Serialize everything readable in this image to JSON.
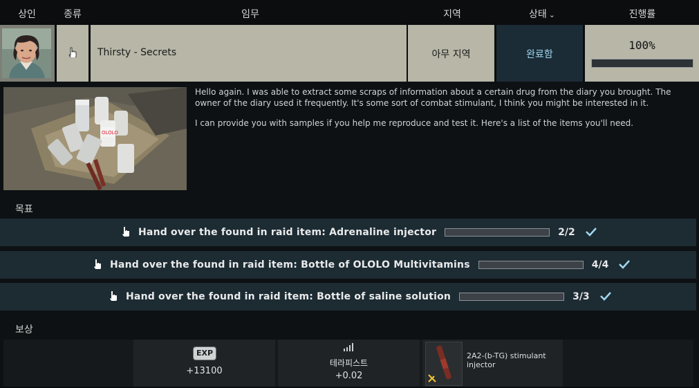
{
  "header": {
    "trader": "상인",
    "type": "종류",
    "task": "임무",
    "location": "지역",
    "status": "상태",
    "progress": "진행률"
  },
  "quest": {
    "title": "Thirsty - Secrets",
    "location": "아무 지역",
    "status": "완료함",
    "progress_text": "100%",
    "progress_value": 1.0
  },
  "description": {
    "paragraph1": "Hello again. I was able to extract some scraps of information about a certain drug from the diary you brought. The owner of the diary used it frequently. It's some sort of combat stimulant, I think you might be interested in it.",
    "paragraph2": "I can provide you with samples if you help me reproduce and test it. Here's a list of the items you'll need.",
    "image_label": "OLOLO"
  },
  "objectives_label": "목표",
  "objectives": [
    {
      "text": "Hand over the found in raid item: Adrenaline injector",
      "count": "2/2",
      "progress": 1.0
    },
    {
      "text": "Hand over the found in raid item: Bottle of OLOLO Multivitamins",
      "count": "4/4",
      "progress": 1.0
    },
    {
      "text": "Hand over the found in raid item: Bottle of saline solution",
      "count": "3/3",
      "progress": 1.0
    }
  ],
  "rewards_label": "보상",
  "rewards": {
    "exp_badge": "EXP",
    "exp_value": "+13100",
    "rep_name": "테라피스트",
    "rep_value": "+0.02",
    "item_name": "2A2-(b-TG) stimulant injector"
  },
  "colors": {
    "cell_bg": "#b7b6a7",
    "status_bg": "#1b2c36",
    "status_text": "#9fd6ee",
    "objective_bg": "#1d2b33",
    "check": "#9fd6ee"
  },
  "icons": {
    "type": "hand-pointer-icon",
    "objective": "hand-pointer-icon",
    "done": "checkmark-icon",
    "status_sort": "chevron-down-icon",
    "rep": "reputation-bars-icon",
    "item_tool": "tools-icon"
  }
}
